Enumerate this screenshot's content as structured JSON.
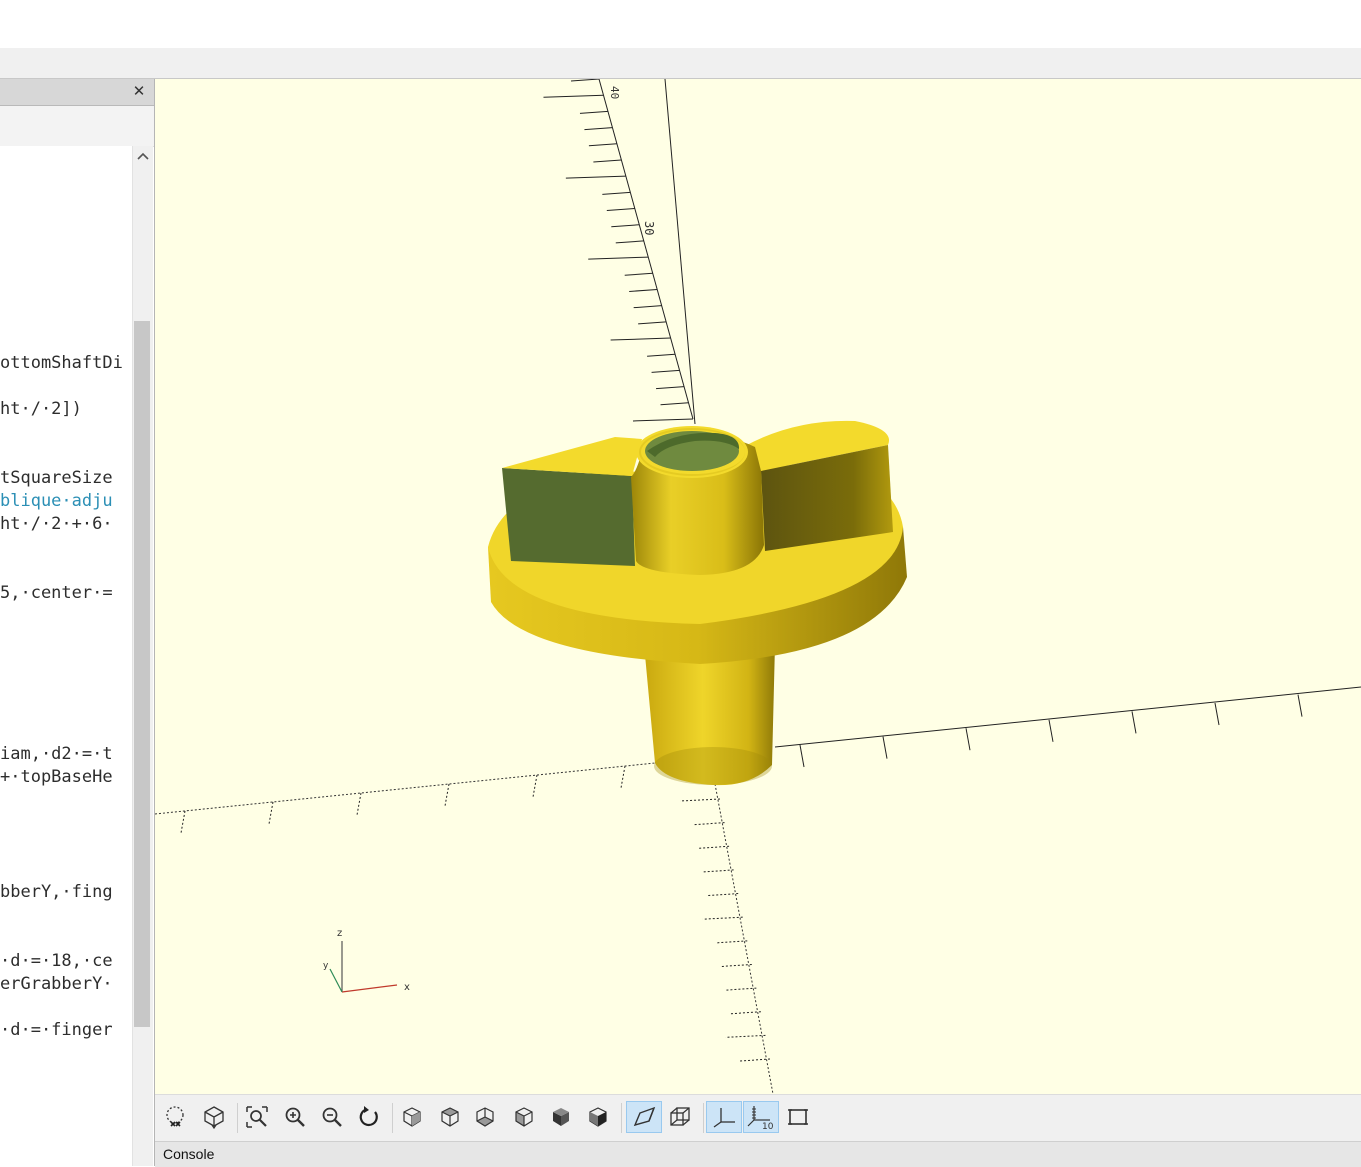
{
  "editor": {
    "close_glyph": "✕",
    "code_lines": [
      {
        "text": "ottomShaftDi",
        "kind": "code"
      },
      {
        "text": "ht·/·2])",
        "kind": "code"
      },
      {
        "text": "tSquareSize",
        "kind": "code"
      },
      {
        "text": "blique·adju",
        "kind": "comment"
      },
      {
        "text": "ht·/·2·+·6·",
        "kind": "code"
      },
      {
        "text": "5,·center·=",
        "kind": "code"
      },
      {
        "text": "iam,·d2·=·t",
        "kind": "code"
      },
      {
        "text": "+·topBaseHe",
        "kind": "code"
      },
      {
        "text": "bberY,·fing",
        "kind": "code"
      },
      {
        "text": "·d·=·18,·ce",
        "kind": "code"
      },
      {
        "text": "erGrabberY·",
        "kind": "code"
      },
      {
        "text": "·d·=·finger",
        "kind": "code"
      }
    ]
  },
  "viewport": {
    "background": "#ffffe5",
    "model_color": "#f0d92a",
    "axis_labels": {
      "x": "x",
      "y": "y",
      "z": "z"
    },
    "ruler_labels": [
      "40",
      "30"
    ]
  },
  "toolbar": {
    "buttons": [
      {
        "name": "preview-button",
        "icon": "preview-icon",
        "active": false
      },
      {
        "name": "render-button",
        "icon": "render-icon",
        "active": false
      },
      {
        "name": "view-all-button",
        "icon": "view-all-icon",
        "active": false
      },
      {
        "name": "zoom-in-button",
        "icon": "zoom-in-icon",
        "active": false
      },
      {
        "name": "zoom-out-button",
        "icon": "zoom-out-icon",
        "active": false
      },
      {
        "name": "reset-view-button",
        "icon": "reset-view-icon",
        "active": false
      },
      {
        "name": "view-right-button",
        "icon": "view-right-icon",
        "active": false
      },
      {
        "name": "view-top-button",
        "icon": "view-top-icon",
        "active": false
      },
      {
        "name": "view-bottom-button",
        "icon": "view-bottom-icon",
        "active": false
      },
      {
        "name": "view-left-button",
        "icon": "view-left-icon",
        "active": false
      },
      {
        "name": "view-front-button",
        "icon": "view-front-icon",
        "active": false
      },
      {
        "name": "view-back-button",
        "icon": "view-back-icon",
        "active": false
      },
      {
        "name": "perspective-button",
        "icon": "perspective-icon",
        "active": true
      },
      {
        "name": "orthogonal-button",
        "icon": "orthogonal-icon",
        "active": false
      },
      {
        "name": "show-axes-button",
        "icon": "axes-icon",
        "active": true
      },
      {
        "name": "show-scale-markers-button",
        "icon": "scale-markers-icon",
        "active": true
      },
      {
        "name": "show-edges-button",
        "icon": "edges-icon",
        "active": false
      }
    ],
    "scale_marker_label": "10"
  },
  "console": {
    "label": "Console"
  }
}
